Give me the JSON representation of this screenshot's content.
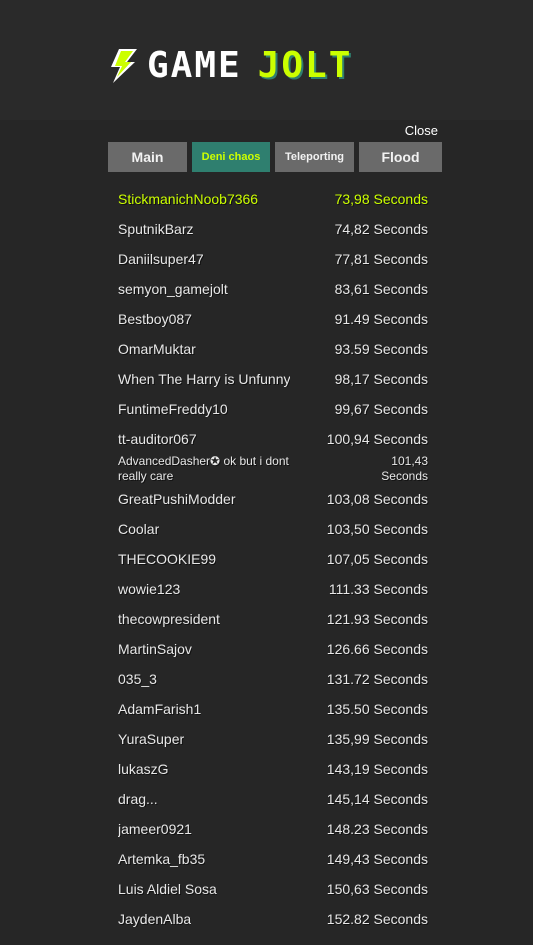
{
  "logo": {
    "word1": "GAME",
    "word2": "JOLT",
    "icon": "bolt-icon"
  },
  "close_label": "Close",
  "tabs": [
    {
      "label": "Main"
    },
    {
      "label": "Deni chaos"
    },
    {
      "label": "Teleporting"
    },
    {
      "label": "Flood"
    }
  ],
  "colors": {
    "accent": "#ccff00",
    "teal": "#2f7f6f",
    "tab_bg": "#6a6a6a",
    "bg": "#2b2b2b"
  },
  "scores": [
    {
      "name": "StickmanichNoob7366",
      "score": "73,98 Seconds"
    },
    {
      "name": "SputnikBarz",
      "score": "74,82 Seconds"
    },
    {
      "name": "Daniilsuper47",
      "score": "77,81 Seconds"
    },
    {
      "name": "semyon_gamejolt",
      "score": "83,61 Seconds"
    },
    {
      "name": "Bestboy087",
      "score": "91.49 Seconds"
    },
    {
      "name": "OmarMuktar",
      "score": "93.59 Seconds"
    },
    {
      "name": "When The Harry is Unfunny",
      "score": "98,17 Seconds"
    },
    {
      "name": "FuntimeFreddy10",
      "score": "99,67 Seconds"
    },
    {
      "name": "tt-auditor067",
      "score": "100,94 Seconds"
    },
    {
      "name": "AdvancedDasher✪ ok but i dont really care",
      "score": "101,43 Seconds"
    },
    {
      "name": "GreatPushiModder",
      "score": "103,08 Seconds"
    },
    {
      "name": "Coolar",
      "score": "103,50 Seconds"
    },
    {
      "name": "THECOOKIE99",
      "score": "107,05 Seconds"
    },
    {
      "name": "wowie123",
      "score": "111.33 Seconds"
    },
    {
      "name": "thecowpresident",
      "score": "121.93 Seconds"
    },
    {
      "name": "MartinSajov",
      "score": "126.66 Seconds"
    },
    {
      "name": "035_3",
      "score": "131.72 Seconds"
    },
    {
      "name": "AdamFarish1",
      "score": "135.50 Seconds"
    },
    {
      "name": "YuraSuper",
      "score": "135,99 Seconds"
    },
    {
      "name": "lukaszG",
      "score": "143,19 Seconds"
    },
    {
      "name": "drag...",
      "score": "145,14 Seconds"
    },
    {
      "name": "jameer0921",
      "score": "148.23 Seconds"
    },
    {
      "name": "Artemka_fb35",
      "score": "149,43 Seconds"
    },
    {
      "name": "Luis Aldiel Sosa",
      "score": "150,63 Seconds"
    },
    {
      "name": "JaydenAlba",
      "score": "152.82 Seconds"
    }
  ]
}
